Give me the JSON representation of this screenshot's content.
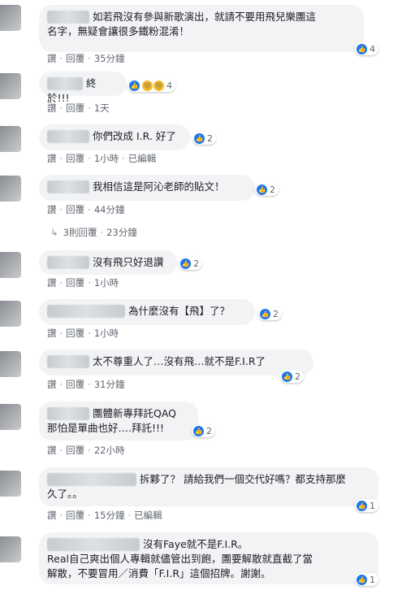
{
  "labels": {
    "like": "讚",
    "reply": "回覆",
    "dot": "·"
  },
  "colors": {
    "bubble": "#f2f3f5",
    "like": "#1877f2",
    "meta": "#606770"
  },
  "comments": [
    {
      "line1": "如若飛沒有參與新歌演出，就請不要用飛兒樂團這",
      "line2": "名字，無疑會讓很多鐵粉混淆！",
      "react_count": "4",
      "time": "35分鐘",
      "edited": ""
    },
    {
      "line1": "終於!!!",
      "react_count": "4",
      "time": "1天",
      "edited": ""
    },
    {
      "line1": "你們改成 I.R. 好了",
      "react_count": "2",
      "time": "1小時",
      "edited": "已編輯"
    },
    {
      "line1": "我相信這是阿沁老師的貼文！",
      "react_count": "2",
      "time": "44分鐘",
      "edited": ""
    },
    {
      "line1": "沒有飛只好退讚",
      "react_count": "2",
      "time": "1小時",
      "edited": ""
    },
    {
      "line1": "為什麼沒有【飛】了？",
      "react_count": "2",
      "time": "1小時",
      "edited": ""
    },
    {
      "line1": "太不尊重人了…沒有飛…就不是F.I.R了",
      "react_count": "2",
      "time": "31分鐘",
      "edited": ""
    },
    {
      "line1": "團體新專拜託QAQ",
      "line2": "那怕是單曲也好….拜託!!!",
      "react_count": "2",
      "time": "22小時",
      "edited": ""
    },
    {
      "line1": "拆夥了？ 請給我們一個交代好嗎？都支持那麼",
      "line2": "久了。。",
      "react_count": "1",
      "time": "15分鐘",
      "edited": "已編輯"
    },
    {
      "line1": "沒有Faye就不是F.I.R。",
      "line2": "Real自己爽出個人專輯就儘管出到飽，團要解散就直截了當",
      "line3": "解散，不要冒用／消費「F.I.R」這個招牌。謝謝。",
      "react_count": "1",
      "time": "",
      "edited": ""
    }
  ],
  "thread": {
    "replies_label": "3則回覆",
    "replies_time": "23分鐘"
  }
}
